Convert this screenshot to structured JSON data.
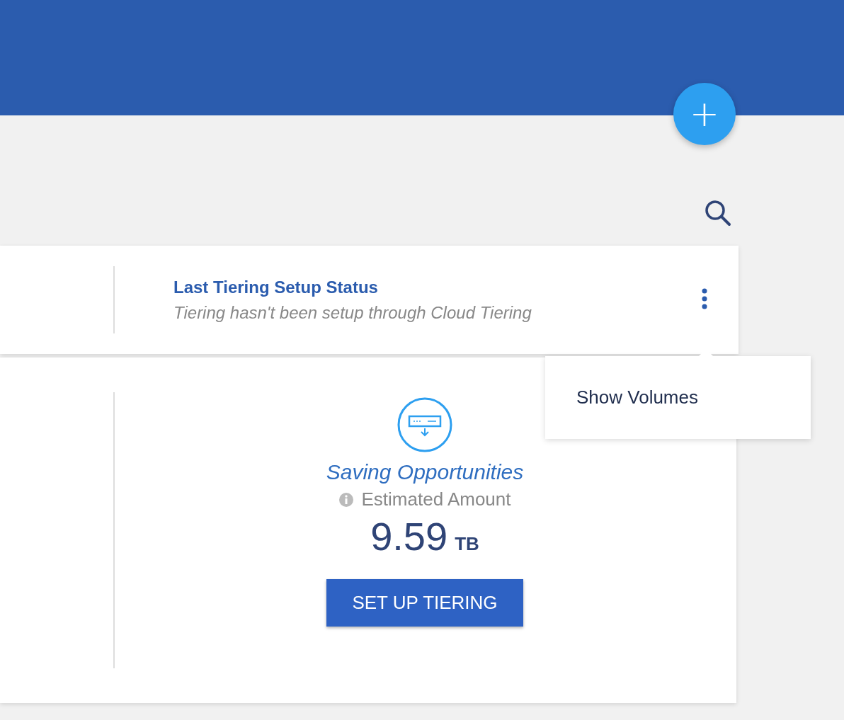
{
  "header": {
    "add_button": "+"
  },
  "status_card": {
    "title": "Last Tiering Setup Status",
    "subtitle": "Tiering hasn't been setup through Cloud Tiering"
  },
  "menu": {
    "items": [
      "Show Volumes"
    ]
  },
  "savings_card": {
    "title": "Saving Opportunities",
    "label": "Estimated Amount",
    "value": "9.59",
    "unit": "TB",
    "button": "SET UP TIERING"
  }
}
